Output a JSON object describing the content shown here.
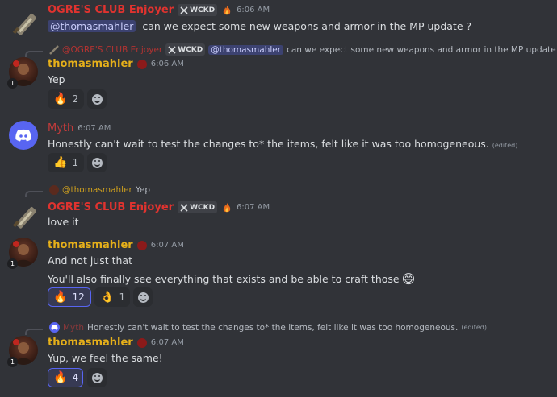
{
  "users": {
    "ogre": "OGRE'S CLUB Enjoyer",
    "mahler": "thomasmahler",
    "myth": "Myth",
    "mahler_mention": "@thomasmahler",
    "ogre_mention": "@OGRE'S CLUB Enjoyer"
  },
  "tag_label": "WCKD",
  "messages": {
    "m1": {
      "time": "6:06 AM",
      "text": "can we expect some new weapons and armor in the MP update ?"
    },
    "m2": {
      "reply_text": "can we expect some new weapons and armor in the MP update ?",
      "time": "6:06 AM",
      "text": "Yep"
    },
    "m3": {
      "time": "6:07 AM",
      "text": "Honestly can't wait to test the changes to* the items, felt like it was too homogeneous.",
      "edited": "(edited)"
    },
    "m4": {
      "reply_text": "Yep",
      "time": "6:07 AM",
      "text": "love it"
    },
    "m5": {
      "time": "6:07 AM",
      "line1": "And not just that",
      "line2": "You'll also finally see everything that exists and be able to craft those"
    },
    "m6": {
      "reply_text": "Honestly can't wait to test the changes to* the items, felt like it was too homogeneous.",
      "reply_edited": "(edited)",
      "time": "6:07 AM",
      "text": "Yup, we feel the same!"
    }
  },
  "reactions": {
    "r1": {
      "emoji": "🔥",
      "count": "2"
    },
    "r2": {
      "emoji": "👍",
      "count": "1"
    },
    "r3": {
      "emoji": "🔥",
      "count": "12"
    },
    "r4": {
      "emoji": "👌",
      "count": "1"
    },
    "r5": {
      "emoji": "🔥",
      "count": "4"
    }
  },
  "inline_emoji": "😄",
  "colors": {
    "background": "#313338",
    "ogre_name": "#e0332f",
    "mahler_name": "#e6b01a",
    "myth_name": "#c23b3b",
    "accent": "#5865f2"
  }
}
